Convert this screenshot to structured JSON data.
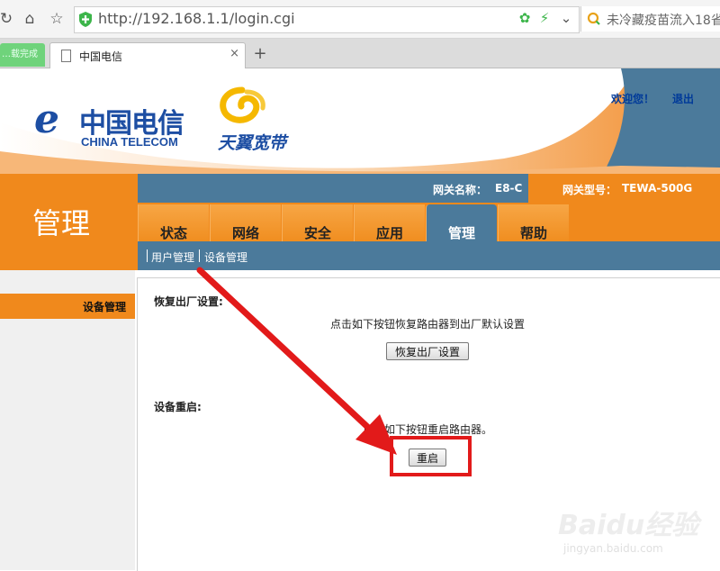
{
  "browser": {
    "url": "http://192.168.1.1/login.cgi",
    "search_text": "未冷藏疫苗流入18省",
    "tabs": [
      {
        "label": "…载完成"
      },
      {
        "label": "中国电信"
      }
    ],
    "new_tab": "+",
    "close_tab": "×"
  },
  "header": {
    "logo_cn": "中国电信",
    "logo_en": "CHINA TELECOM",
    "brand_tianyi": "天翼宽带",
    "welcome": "欢迎您！",
    "logout": "退出"
  },
  "section": {
    "title": "管理"
  },
  "gateway": {
    "name_label": "网关名称：",
    "name_value": "E8-C",
    "model_label": "网关型号：",
    "model_value": "TEWA-500G"
  },
  "menu": {
    "items": [
      {
        "label": "状态"
      },
      {
        "label": "网络"
      },
      {
        "label": "安全"
      },
      {
        "label": "应用"
      },
      {
        "label": "管理"
      },
      {
        "label": "帮助"
      }
    ],
    "active": "管理"
  },
  "submenu": {
    "items": [
      {
        "label": "用户管理"
      },
      {
        "label": "设备管理"
      }
    ]
  },
  "sidebar": {
    "items": [
      {
        "label": "设备管理"
      }
    ]
  },
  "content": {
    "factory_heading": "恢复出厂设置:",
    "factory_desc": "点击如下按钮恢复路由器到出厂默认设置",
    "factory_button": "恢复出厂设置",
    "reboot_heading": "设备重启:",
    "reboot_desc": "点击如下按钮重启路由器。",
    "reboot_button": "重启"
  },
  "annotation": {
    "arrow_color": "#e21a1a"
  },
  "colors": {
    "orange": "#f0891c",
    "steel_blue": "#4b7a9b",
    "brand_blue": "#1d4ea3"
  },
  "watermark": {
    "brand": "Baidu经验",
    "url": "jingyan.baidu.com"
  }
}
